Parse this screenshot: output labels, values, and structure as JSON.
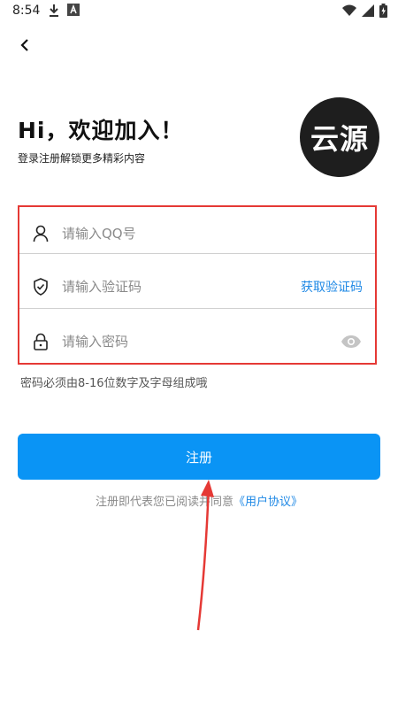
{
  "status_bar": {
    "time": "8:54",
    "icons_left": [
      "download-icon",
      "a-notification-icon"
    ],
    "icons_right": [
      "wifi-icon",
      "signal-icon",
      "battery-icon"
    ]
  },
  "nav": {
    "back_icon": "chevron-left-icon"
  },
  "header": {
    "greeting": "Hi，欢迎加入！",
    "subtitle": "登录注册解锁更多精彩内容",
    "logo_text": "云源"
  },
  "form": {
    "qq": {
      "placeholder": "请输入QQ号",
      "value": "",
      "icon": "user-icon"
    },
    "code": {
      "placeholder": "请输入验证码",
      "value": "",
      "icon": "shield-check-icon",
      "action_label": "获取验证码"
    },
    "password": {
      "placeholder": "请输入密码",
      "value": "",
      "icon": "lock-icon",
      "toggle_icon": "eye-icon"
    },
    "hint": "密码必须由8-16位数字及字母组成哦"
  },
  "register_label": "注册",
  "agreement": {
    "prefix": "注册即代表您已阅读并同意",
    "link": "《用户协议》"
  },
  "colors": {
    "primary": "#0a94f5",
    "link": "#1e88e5",
    "highlight_border": "#e53935",
    "arrow": "#e53935"
  }
}
